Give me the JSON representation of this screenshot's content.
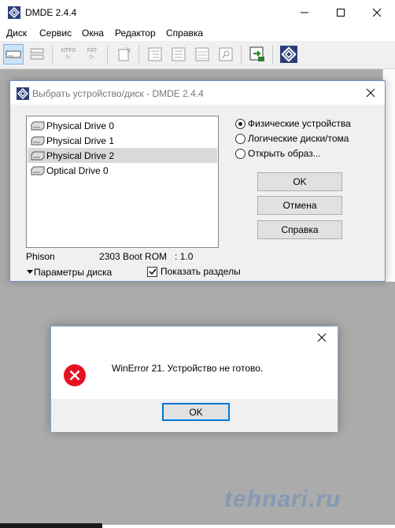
{
  "app": {
    "title": "DMDE 2.4.4",
    "menu": [
      "Диск",
      "Сервис",
      "Окна",
      "Редактор",
      "Справка"
    ],
    "toolbar": {
      "ntfs_label": "NTFS",
      "fat_label": "FAT"
    }
  },
  "select_dialog": {
    "title": "Выбрать устройство/диск - DMDE 2.4.4",
    "devices": [
      {
        "label": "Physical Drive 0",
        "selected": false
      },
      {
        "label": "Physical Drive 1",
        "selected": false
      },
      {
        "label": "Physical Drive 2",
        "selected": true
      },
      {
        "label": "Optical Drive 0",
        "selected": false
      }
    ],
    "radios": [
      {
        "label": "Физические устройства",
        "checked": true
      },
      {
        "label": "Логические диски/тома",
        "checked": false
      },
      {
        "label": "Открыть образ...",
        "checked": false
      }
    ],
    "ok_label": "OK",
    "cancel_label": "Отмена",
    "help_label": "Справка",
    "disk_vendor": "Phison",
    "disk_model": "2303 Boot ROM   : 1.0",
    "disk_params_label": "Параметры диска",
    "show_partitions_label": "Показать разделы",
    "show_partitions_checked": true
  },
  "error_dialog": {
    "message": "WinError 21. Устройство не готово.",
    "ok_label": "OK"
  },
  "watermark": "tehnari.ru",
  "colors": {
    "accent": "#0078d7",
    "error": "#e81123",
    "workspace": "#ababab"
  }
}
